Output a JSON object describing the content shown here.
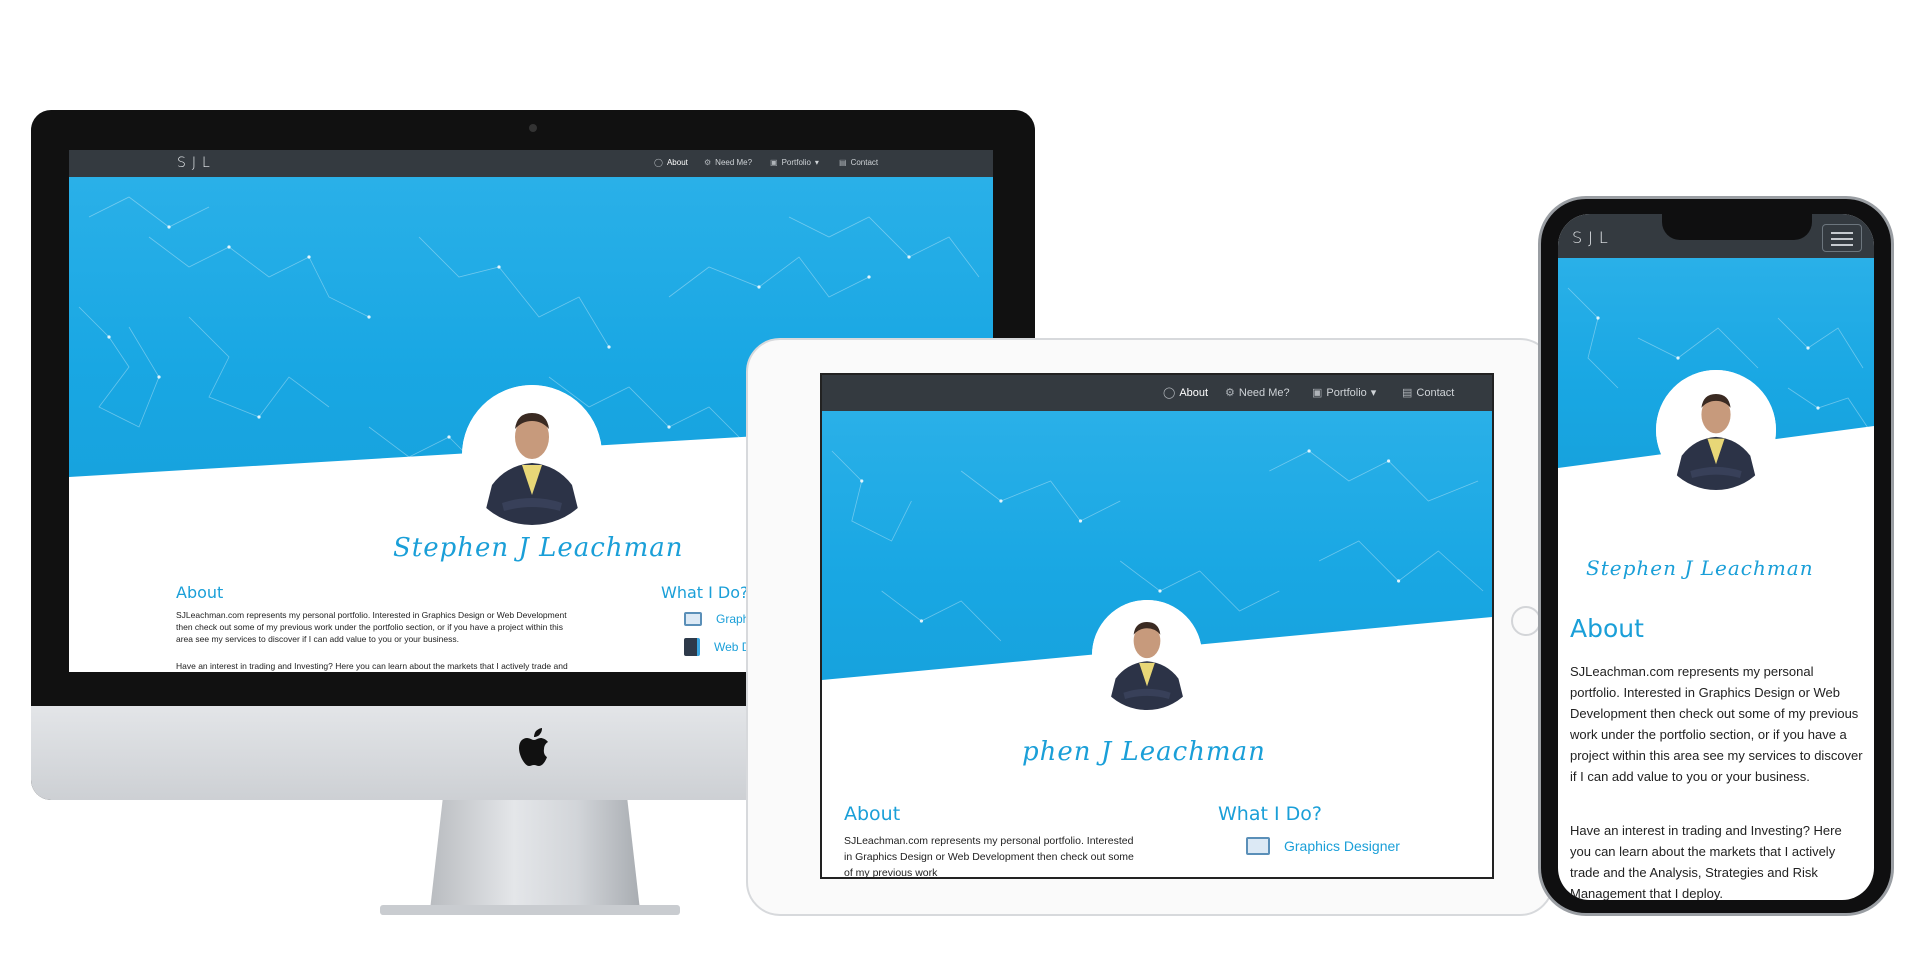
{
  "site": {
    "logo": "SJL",
    "nav": [
      {
        "label": "About",
        "icon": "user-icon"
      },
      {
        "label": "Need Me?",
        "icon": "cogs-icon"
      },
      {
        "label": "Portfolio",
        "icon": "book-icon",
        "caret": "▾"
      },
      {
        "label": "Contact",
        "icon": "id-card-icon"
      }
    ],
    "name": "Stephen J Leachman",
    "about": {
      "title": "About",
      "p1": "SJLeachman.com represents my personal portfolio. Interested in Graphics Design or Web Development then check out some of my previous work under the portfolio section, or if you have a project within this area see my services to discover if I can add value to you or your business.",
      "p2": "Have an interest in trading and Investing? Here you can learn about the markets that I actively trade and the Analysis, Strategies and Risk Management that I deploy."
    },
    "what": {
      "title": "What I Do?",
      "items": [
        {
          "label": "Graphics Designer",
          "icon": "monitor-design-icon"
        },
        {
          "label": "Web Develuper",
          "icon": "web-dev-icon"
        }
      ]
    }
  },
  "ipad_view": {
    "name_partial": "phen J Leachman",
    "about_p1_partial": "SJLeachman.com represents my personal portfolio. Interested in Graphics Design or Web Development then check out some of my previous work"
  },
  "imac_view": {
    "about_p2_partial": "Have an interest in trading and Investing? Here you can learn about the markets that I actively trade and"
  },
  "phone_view": {
    "about_p2_partial": "Have an interest in trading and Investing? Here you can learn about the markets that I actively trade and the Analysis, Strategies and Risk Management that I deploy."
  },
  "colors": {
    "accent": "#1a9fd8",
    "hero_top": "#2ab0e8",
    "navbar": "#343a40"
  }
}
